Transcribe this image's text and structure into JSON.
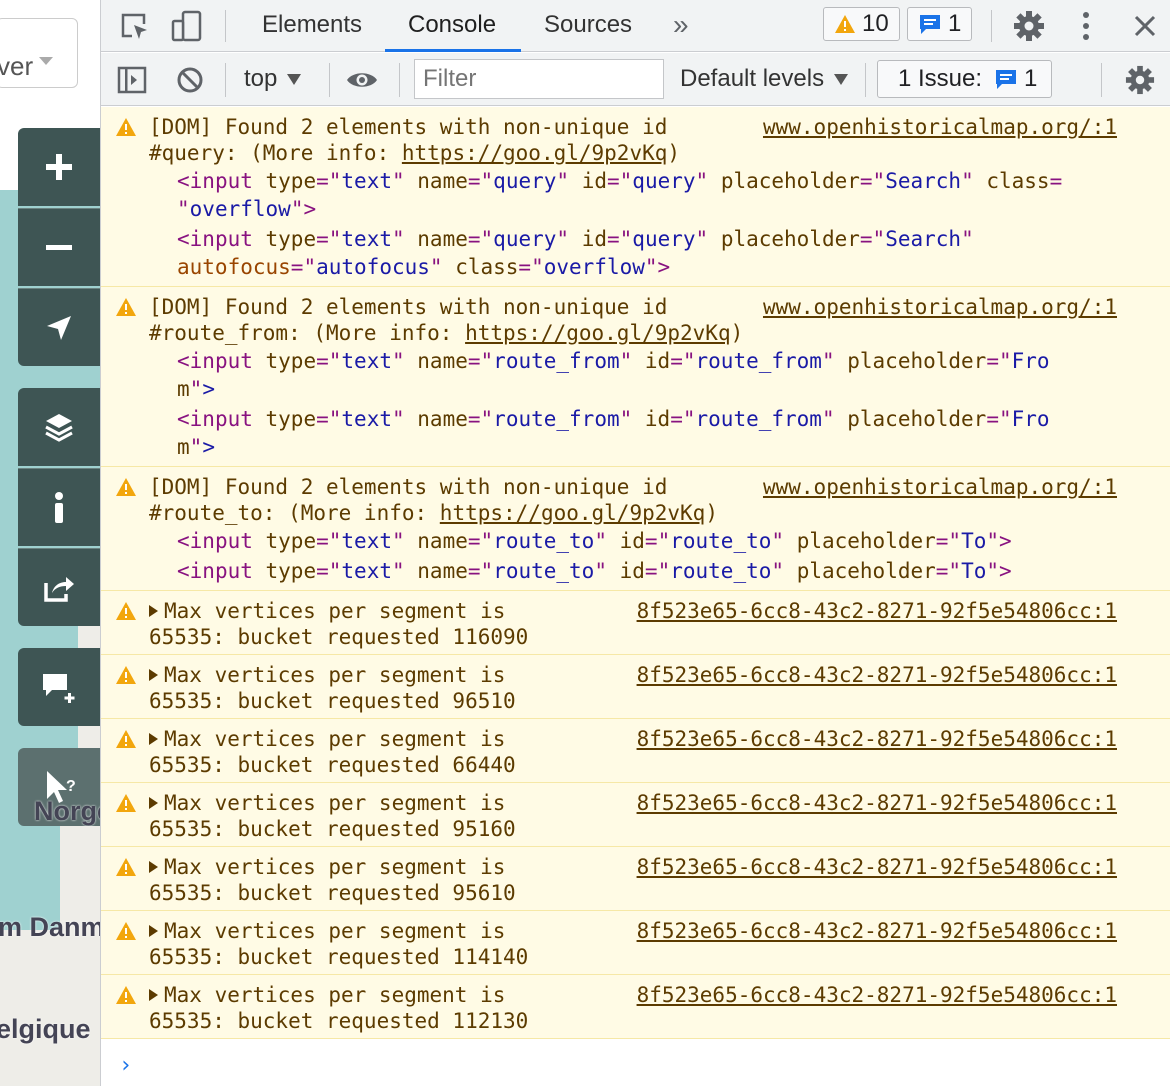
{
  "map": {
    "layer_select_text": "ver",
    "labels": [
      "Norge",
      "m Danm",
      "elgique"
    ]
  },
  "tabs": {
    "elements": "Elements",
    "console": "Console",
    "sources": "Sources",
    "more": "»"
  },
  "badges": {
    "warnings_count": "10",
    "messages_count": "1"
  },
  "toolbar": {
    "context": "top",
    "filter_placeholder": "Filter",
    "levels": "Default levels",
    "issues_label": "1 Issue:",
    "issues_count": "1"
  },
  "colors": {
    "warning_bg": "#fffbe5",
    "warning_text": "#5c3b00",
    "accent": "#1a73e8",
    "map_control": "#3e5554",
    "sea": "#9fd1d0"
  },
  "messages": [
    {
      "text_line1": "[DOM] Found 2 elements with non-unique id",
      "text_line2a": "#query: (More info: ",
      "link": "https://goo.gl/9p2vKq",
      "text_line2b": ")",
      "source": "www.openhistoricalmap.org/:1",
      "code": [
        "<input type=\"text\" name=\"query\" id=\"query\" placeholder=\"Search\" class=",
        "\"overflow\">",
        "<input type=\"text\" name=\"query\" id=\"query\" placeholder=\"Search\"",
        "autofocus=\"autofocus\" class=\"overflow\">"
      ]
    },
    {
      "text_line1": "[DOM] Found 2 elements with non-unique id",
      "text_line2a": "#route_from: (More info: ",
      "link": "https://goo.gl/9p2vKq",
      "text_line2b": ")",
      "source": "www.openhistoricalmap.org/:1",
      "code": [
        "<input type=\"text\" name=\"route_from\" id=\"route_from\" placeholder=\"Fro",
        "m\">",
        "<input type=\"text\" name=\"route_from\" id=\"route_from\" placeholder=\"Fro",
        "m\">"
      ]
    },
    {
      "text_line1": "[DOM] Found 2 elements with non-unique id",
      "text_line2a": "#route_to: (More info: ",
      "link": "https://goo.gl/9p2vKq",
      "text_line2b": ")",
      "source": "www.openhistoricalmap.org/:1",
      "code": [
        "<input type=\"text\" name=\"route_to\" id=\"route_to\" placeholder=\"To\">",
        "<input type=\"text\" name=\"route_to\" id=\"route_to\" placeholder=\"To\">"
      ]
    }
  ],
  "vertex_messages": [
    {
      "line1": "Max vertices per segment is",
      "line2": "65535: bucket requested 116090",
      "source": "8f523e65-6cc8-43c2-8271-92f5e54806cc:1"
    },
    {
      "line1": "Max vertices per segment is",
      "line2": "65535: bucket requested 96510",
      "source": "8f523e65-6cc8-43c2-8271-92f5e54806cc:1"
    },
    {
      "line1": "Max vertices per segment is",
      "line2": "65535: bucket requested 66440",
      "source": "8f523e65-6cc8-43c2-8271-92f5e54806cc:1"
    },
    {
      "line1": "Max vertices per segment is",
      "line2": "65535: bucket requested 95160",
      "source": "8f523e65-6cc8-43c2-8271-92f5e54806cc:1"
    },
    {
      "line1": "Max vertices per segment is",
      "line2": "65535: bucket requested 95610",
      "source": "8f523e65-6cc8-43c2-8271-92f5e54806cc:1"
    },
    {
      "line1": "Max vertices per segment is",
      "line2": "65535: bucket requested 114140",
      "source": "8f523e65-6cc8-43c2-8271-92f5e54806cc:1"
    },
    {
      "line1": "Max vertices per segment is",
      "line2": "65535: bucket requested 112130",
      "source": "8f523e65-6cc8-43c2-8271-92f5e54806cc:1"
    }
  ],
  "prompt_symbol": "›"
}
